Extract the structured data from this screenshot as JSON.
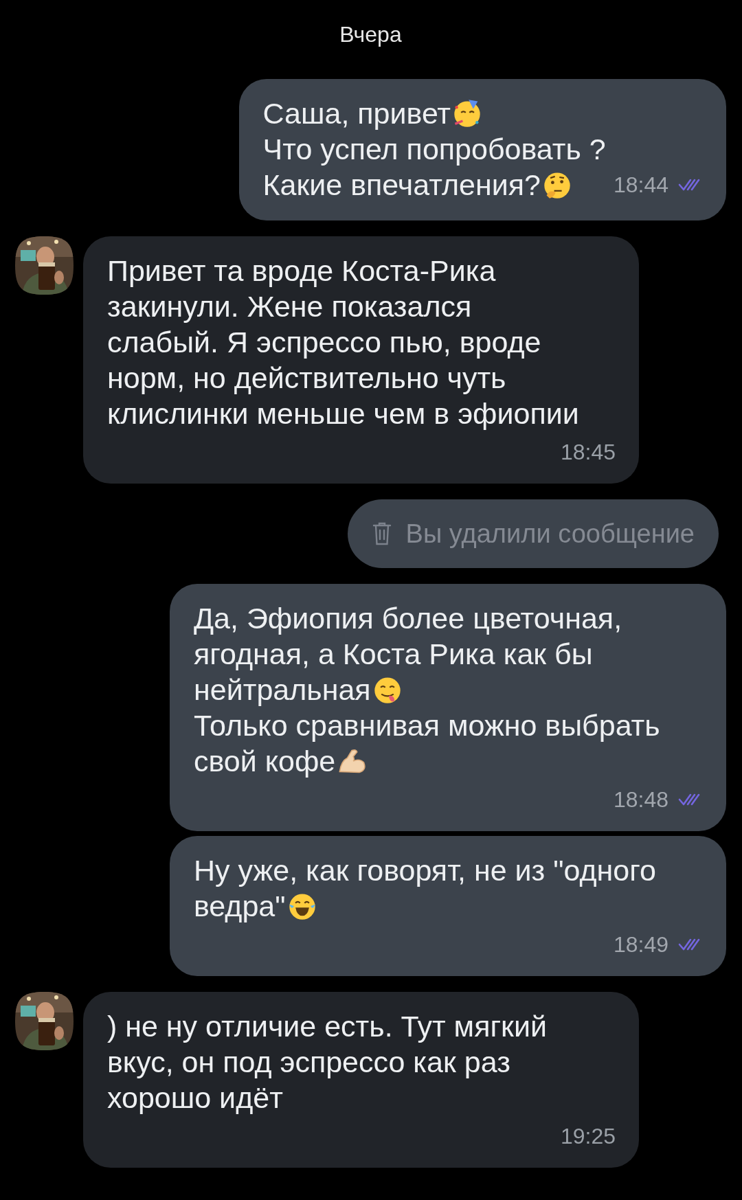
{
  "date_label": "Вчера",
  "messages": [
    {
      "outgoing": true,
      "kind": "text",
      "time_inline": true,
      "read": true,
      "time": "18:44",
      "lines": [
        {
          "text": "Саша, привет",
          "emoji": {
            "kind": "party"
          }
        },
        {
          "text": "Что успел попробовать ?"
        },
        {
          "text": "Какие впечатления?",
          "emoji": {
            "kind": "thinking"
          }
        }
      ]
    },
    {
      "outgoing": false,
      "kind": "text",
      "time_inline": false,
      "read": false,
      "time": "18:45",
      "lines": [
        {
          "text": "Привет та вроде Коста-Рика"
        },
        {
          "text": "закинули. Жене показался"
        },
        {
          "text": "слабый. Я эспрессо пью, вроде"
        },
        {
          "text": "норм, но действительно чуть"
        },
        {
          "text": "клислинки меньше чем в эфиопии"
        }
      ]
    },
    {
      "outgoing": true,
      "kind": "deleted",
      "text": "Вы удалили сообщение"
    },
    {
      "outgoing": true,
      "kind": "text",
      "time_inline": false,
      "read": true,
      "time": "18:48",
      "lines": [
        {
          "text": "Да, Эфиопия более цветочная,"
        },
        {
          "text": "ягодная, а Коста Рика как бы"
        },
        {
          "text": "нейтральная",
          "emoji": {
            "kind": "yum"
          }
        },
        {
          "text": "Только сравнивая можно выбрать"
        },
        {
          "text": "свой кофе",
          "emoji": {
            "kind": "muscle"
          }
        }
      ]
    },
    {
      "outgoing": true,
      "kind": "text",
      "time_inline": false,
      "read": true,
      "time": "18:49",
      "lines": [
        {
          "text": "Ну уже, как говорят, не из \"одного"
        },
        {
          "text": "ведра\"",
          "emoji": {
            "kind": "laugh"
          }
        }
      ]
    },
    {
      "outgoing": false,
      "kind": "text",
      "time_inline": false,
      "read": false,
      "time": "19:25",
      "lines": [
        {
          "text": ") не ну отличие есть. Тут мягкий"
        },
        {
          "text": "вкус, он под эспрессо как раз"
        },
        {
          "text": "хорошо идёт"
        }
      ]
    }
  ]
}
